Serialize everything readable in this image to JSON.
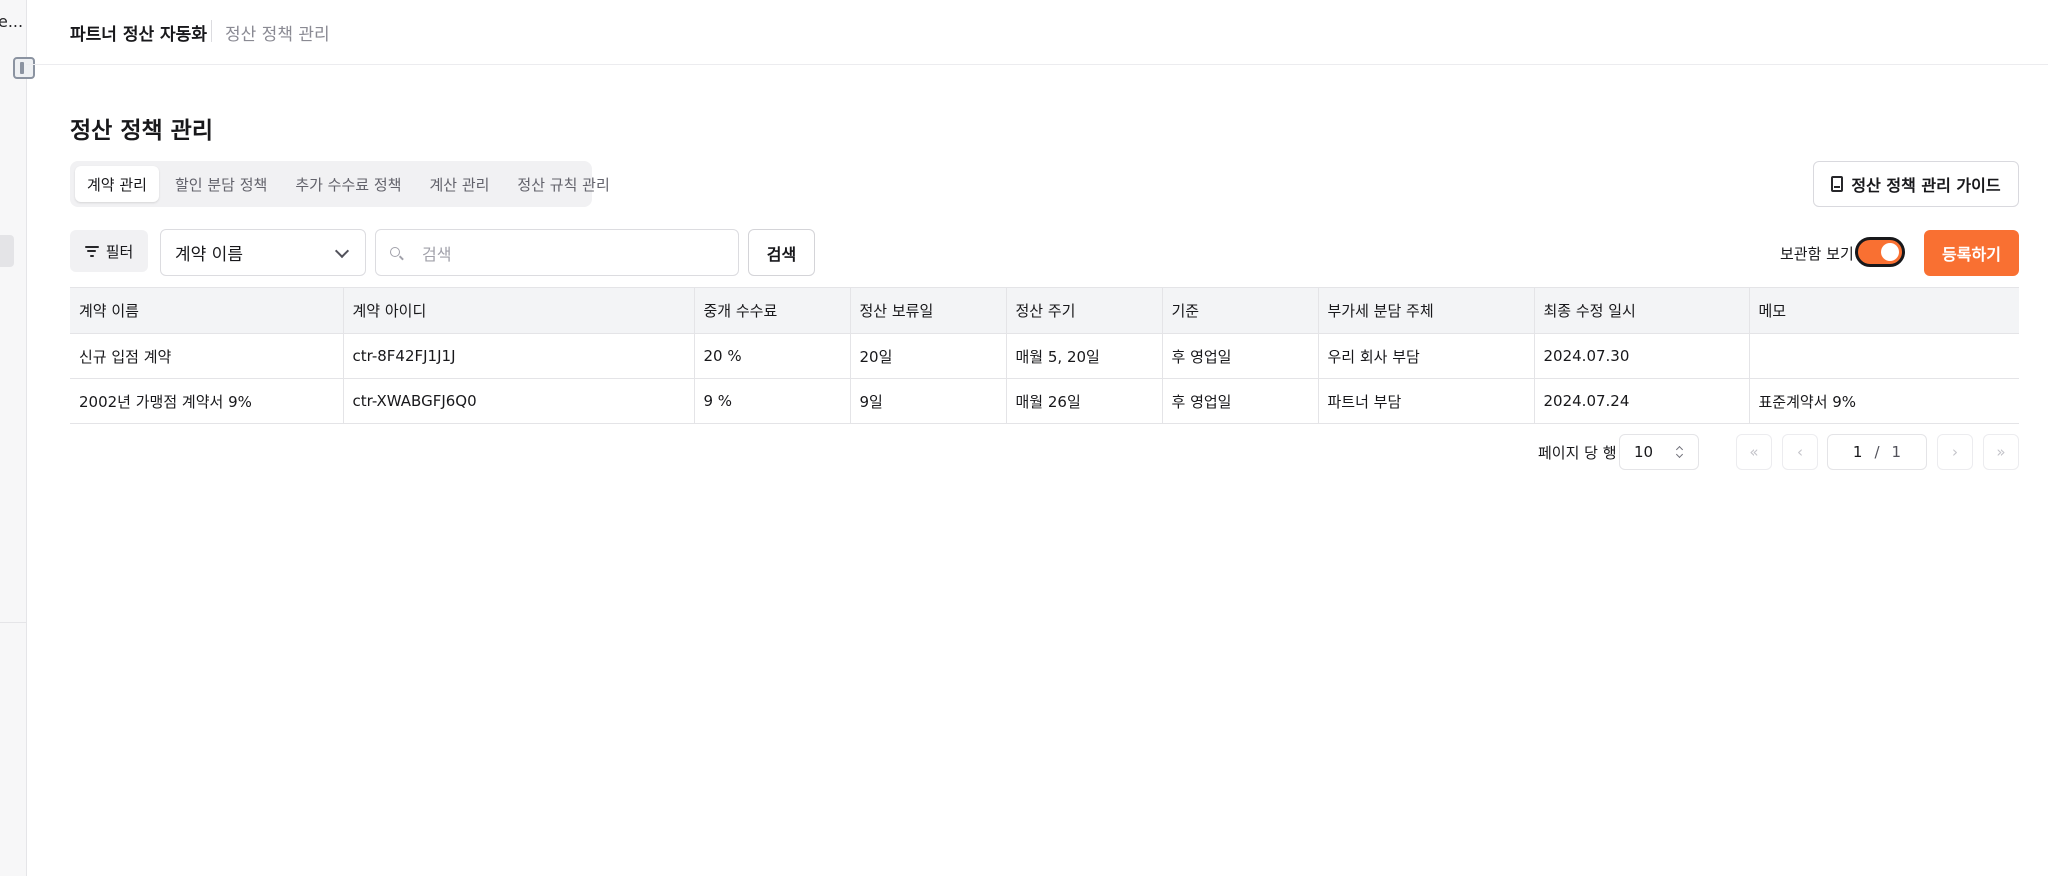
{
  "sidebar": {
    "clipped_text": "e..."
  },
  "breadcrumb": {
    "app": "파트너 정산 자동화",
    "current": "정산 정책 관리"
  },
  "page": {
    "title": "정산 정책 관리"
  },
  "tabs": [
    {
      "label": "계약 관리",
      "active": true
    },
    {
      "label": "할인 분담 정책",
      "active": false
    },
    {
      "label": "추가 수수료 정책",
      "active": false
    },
    {
      "label": "계산 관리",
      "active": false
    },
    {
      "label": "정산 규칙 관리",
      "active": false
    }
  ],
  "guide": {
    "label": "정산 정책 관리 가이드"
  },
  "toolbar": {
    "filter_label": "필터",
    "select_value": "계약 이름",
    "search_placeholder": "검색",
    "search_button": "검색",
    "archive_label": "보관함 보기",
    "archive_on": true,
    "register_label": "등록하기"
  },
  "table": {
    "headers": [
      "계약 이름",
      "계약 아이디",
      "중개 수수료",
      "정산 보류일",
      "정산 주기",
      "기준",
      "부가세 분담 주체",
      "최종 수정 일시",
      "메모"
    ],
    "rows": [
      [
        "신규 입점 계약",
        "ctr-8F42FJ1J1J",
        "20 %",
        "20일",
        "매월 5, 20일",
        "후 영업일",
        "우리 회사 부담",
        "2024.07.30",
        ""
      ],
      [
        "2002년 가맹점 계약서 9%",
        "ctr-XWABGFJ6Q0",
        "9 %",
        "9일",
        "매월 26일",
        "후 영업일",
        "파트너 부담",
        "2024.07.24",
        "표준계약서 9%"
      ]
    ]
  },
  "pagination": {
    "rows_label": "페이지 당 행",
    "rows_per_page": "10",
    "current_page": "1",
    "separator": "/",
    "total_pages": "1",
    "first_icon": "«",
    "prev_icon": "‹",
    "next_icon": "›",
    "last_icon": "»"
  },
  "colors": {
    "accent": "#f97032"
  }
}
